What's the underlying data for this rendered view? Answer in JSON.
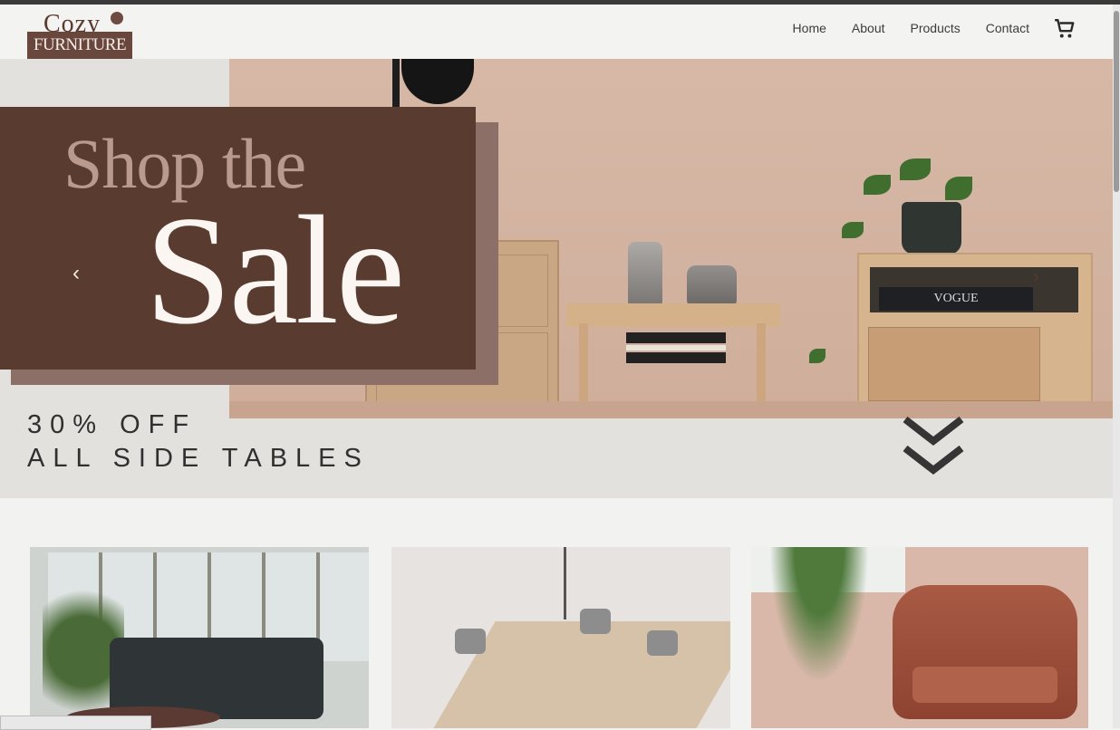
{
  "logo": {
    "top": "Cozy",
    "bottom": "FURNITURE"
  },
  "nav": {
    "items": [
      "Home",
      "About",
      "Products",
      "Contact"
    ]
  },
  "icons": {
    "cart": "cart-icon",
    "prev": "chevron-left-icon",
    "next": "chevron-right-icon",
    "scroll": "double-chevron-down-icon"
  },
  "hero": {
    "headline_small": "Shop the",
    "headline_large": "Sale",
    "prev_glyph": "‹",
    "next_glyph": "›",
    "offer_line1": "30% OFF",
    "offer_line2": "ALL SIDE TABLES",
    "magazine": "VOGUE"
  },
  "colors": {
    "brand_brown": "#5a3b30",
    "background": "#f2f2f1"
  }
}
